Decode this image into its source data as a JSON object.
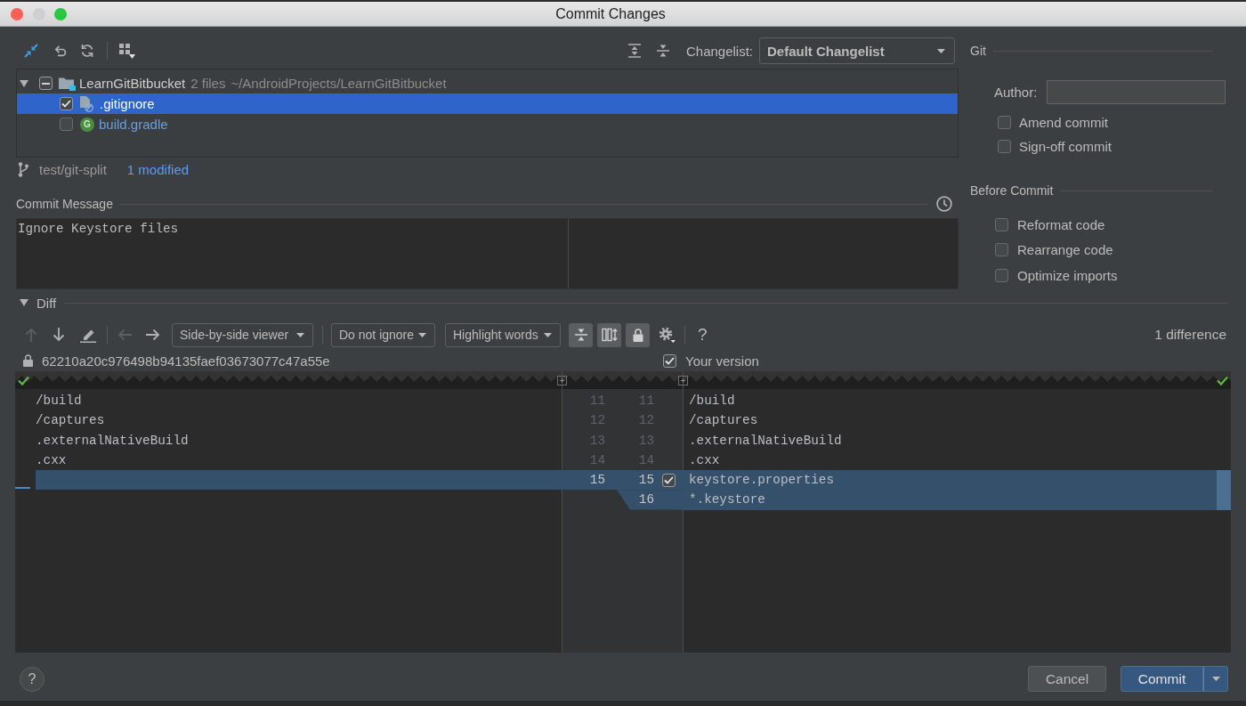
{
  "window": {
    "title": "Commit Changes",
    "controls": [
      {
        "kind": "close",
        "disabled": false
      },
      {
        "kind": "minimize",
        "disabled": true
      },
      {
        "kind": "zoom",
        "disabled": false
      }
    ]
  },
  "changelist": {
    "label": "Changelist:",
    "value": "Default Changelist"
  },
  "tree": {
    "root": {
      "name": "LearnGitBitbucket",
      "count": "2 files",
      "path": "~/AndroidProjects/LearnGitBitbucket",
      "expanded": true,
      "partial": true,
      "selected": false,
      "children": [
        {
          "name": ".gitignore",
          "kind": "ignored",
          "checked": true,
          "selected": true
        },
        {
          "name": "build.gradle",
          "kind": "script",
          "badge": "G",
          "checked": false,
          "selected": false
        }
      ]
    }
  },
  "branch": {
    "name": "test/git-split",
    "changes": "1 modified"
  },
  "commit_message": {
    "label": "Commit Message",
    "value": "Ignore Keystore files"
  },
  "git": {
    "title": "Git",
    "author_label": "Author:",
    "options": [
      {
        "label": "Amend commit",
        "checked": false
      },
      {
        "label": "Sign-off commit",
        "checked": false
      }
    ]
  },
  "before_commit": {
    "title": "Before Commit",
    "options": [
      {
        "label": "Reformat code",
        "checked": false
      },
      {
        "label": "Rearrange code",
        "checked": false
      },
      {
        "label": "Optimize imports",
        "checked": false
      }
    ]
  },
  "diff": {
    "title": "Diff",
    "expanded": true,
    "change_nav": [
      {
        "kind": "up",
        "disabled": true
      },
      {
        "kind": "down",
        "disabled": false
      },
      {
        "kind": "edit",
        "disabled": false
      }
    ],
    "file_nav": [
      {
        "kind": "back",
        "disabled": true
      },
      {
        "kind": "forward",
        "disabled": false
      }
    ],
    "viewer": "Side-by-side viewer",
    "ignore": "Do not ignore",
    "highlight": "Highlight words",
    "toggles": [
      {
        "kind": "collapse",
        "on": true
      },
      {
        "kind": "sync",
        "on": true
      },
      {
        "kind": "lock",
        "on": true
      }
    ],
    "help": "?",
    "summary": "1 difference",
    "left": {
      "title": "62210a20c976498b94135faef03673077c47a55e"
    },
    "right": {
      "title": "Your version",
      "checked": true
    },
    "lines": [
      {
        "left_number": "11",
        "left_text": "/build",
        "right_number": "11",
        "right_text": "/build",
        "changed": false
      },
      {
        "left_number": "12",
        "left_text": "/captures",
        "right_number": "12",
        "right_text": "/captures",
        "changed": false
      },
      {
        "left_number": "13",
        "left_text": ".externalNativeBuild",
        "right_number": "13",
        "right_text": ".externalNativeBuild",
        "changed": false
      },
      {
        "left_number": "14",
        "left_text": ".cxx",
        "right_number": "14",
        "right_text": ".cxx",
        "changed": false
      },
      {
        "left_number": "15",
        "right_number": "15",
        "right_text": "keystore.properties",
        "changed": true,
        "included": true
      },
      {
        "right_number": "16",
        "right_text": "*.keystore",
        "changed": true
      }
    ]
  },
  "footer": {
    "help": "?",
    "buttons": [
      {
        "label": "Cancel",
        "kind": "secondary"
      },
      {
        "label": "Commit",
        "kind": "primary"
      }
    ]
  }
}
